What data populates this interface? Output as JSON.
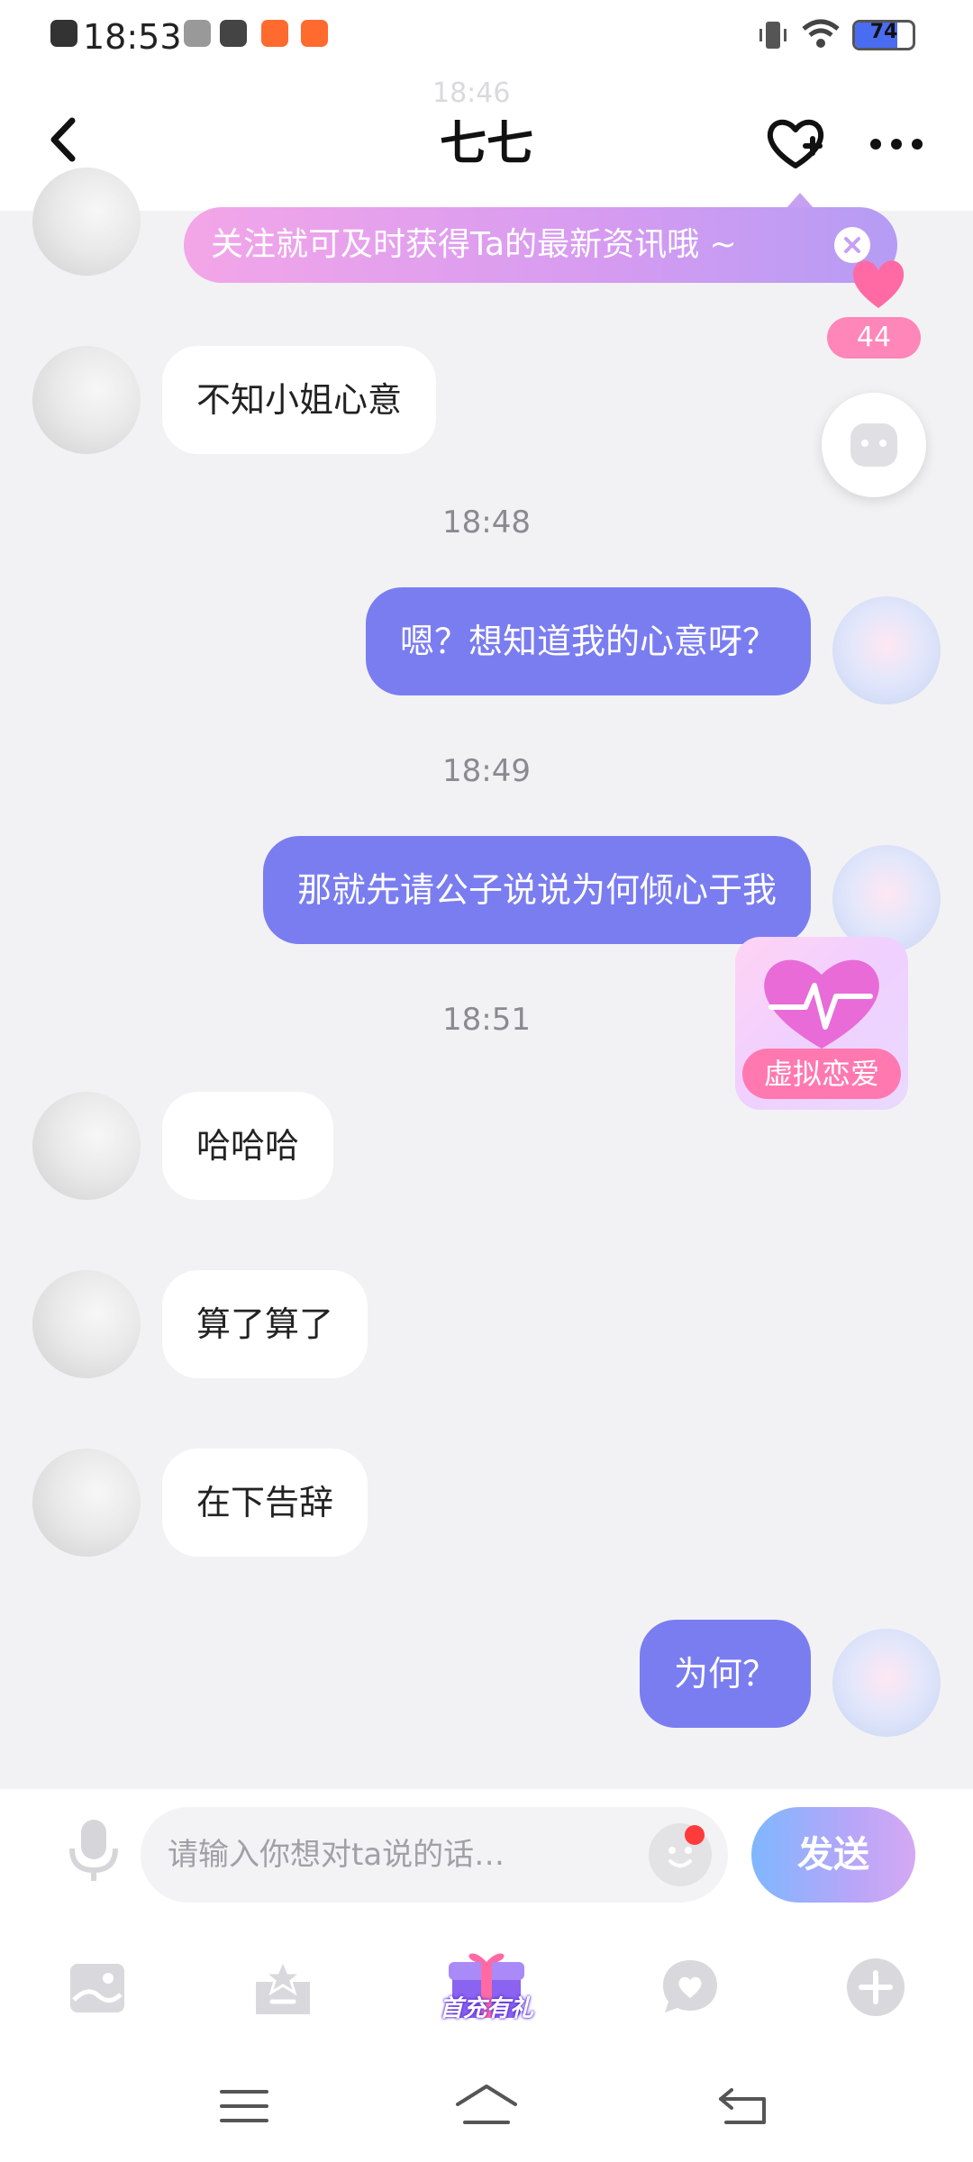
{
  "status_bar": {
    "time": "18:53",
    "battery": "74"
  },
  "header": {
    "title": "七七",
    "ghost_time": "18:46"
  },
  "follow_tip": {
    "text": "关注就可及时获得Ta的最新资讯哦 ~"
  },
  "likes": {
    "count": "44"
  },
  "messages": [
    {
      "side": "left",
      "text": "不知小姐心意"
    },
    {
      "timestamp": "18:48"
    },
    {
      "side": "right",
      "text": "嗯？想知道我的心意呀？"
    },
    {
      "timestamp": "18:49"
    },
    {
      "side": "right",
      "text": "那就先请公子说说为何倾心于我"
    },
    {
      "timestamp": "18:51"
    },
    {
      "side": "left",
      "text": "哈哈哈"
    },
    {
      "side": "left",
      "text": "算了算了"
    },
    {
      "side": "left",
      "text": "在下告辞"
    },
    {
      "side": "right",
      "text": "为何？"
    }
  ],
  "floating": {
    "virtual_love_label": "虚拟恋爱"
  },
  "input": {
    "placeholder": "请输入你想对ta说的话…",
    "send_label": "发送"
  },
  "toolbar": {
    "gift_label": "首充有礼"
  },
  "icons": {
    "back": "chevron-left-icon",
    "follow": "heart-plus-icon",
    "more": "more-dots-icon",
    "mic": "microphone-icon",
    "emoji": "emoji-icon",
    "image": "image-icon",
    "star": "star-box-icon",
    "gift": "gift-icon",
    "heart_chat": "heart-chat-icon",
    "plus": "plus-icon"
  },
  "colors": {
    "bubble_right": "#7a7df0",
    "bubble_left": "#ffffff",
    "send_gradient_start": "#7fb7ff",
    "send_gradient_end": "#d5a8f4",
    "tip_gradient_start": "#f3a6e8",
    "tip_gradient_end": "#b59cf4"
  }
}
